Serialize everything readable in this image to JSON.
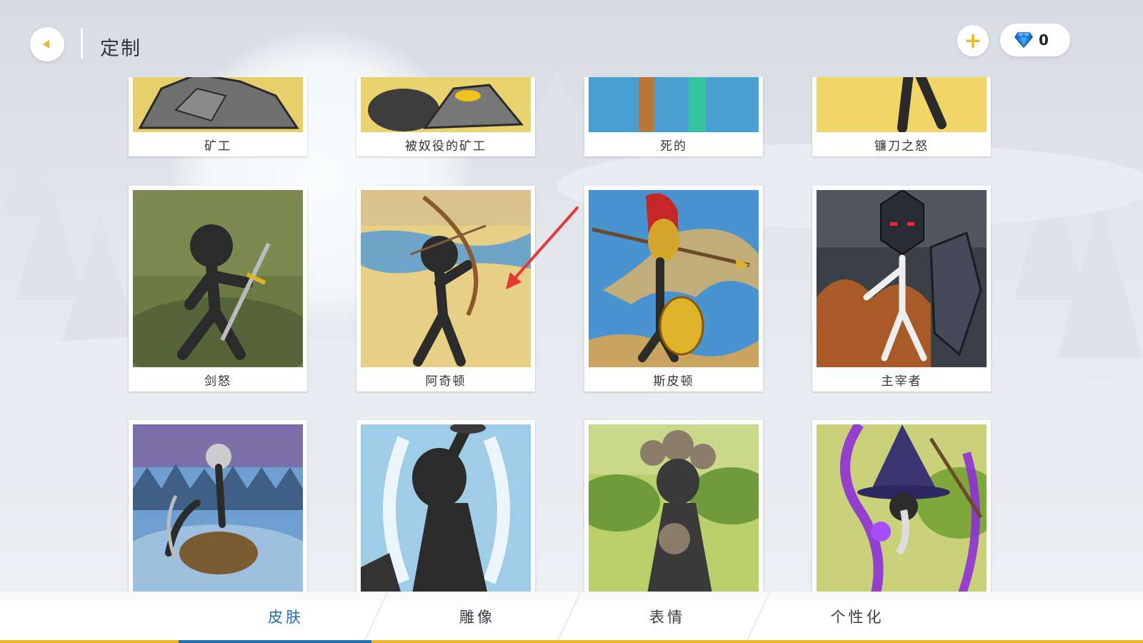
{
  "header": {
    "title": "定制",
    "gem_count": "0",
    "back_icon": "back-arrow-icon",
    "add_icon": "plus-icon",
    "gem_icon": "blue-diamond-icon"
  },
  "colors": {
    "accent_gold": "#f0b62a",
    "active_tab": "#1f6fb5",
    "gem_blue": "#1e88e5",
    "annotation_red": "#e53935"
  },
  "cards": [
    {
      "label": "矿工"
    },
    {
      "label": "被奴役的矿工"
    },
    {
      "label": "死的"
    },
    {
      "label": "镰刀之怒"
    },
    {
      "label": "剑怒"
    },
    {
      "label": "阿奇顿"
    },
    {
      "label": "斯皮顿"
    },
    {
      "label": "主宰者"
    },
    {
      "label": ""
    },
    {
      "label": ""
    },
    {
      "label": ""
    },
    {
      "label": ""
    }
  ],
  "tabs": [
    {
      "label": "皮肤",
      "active": true
    },
    {
      "label": "雕像",
      "active": false
    },
    {
      "label": "表情",
      "active": false
    },
    {
      "label": "个性化",
      "active": false
    }
  ]
}
